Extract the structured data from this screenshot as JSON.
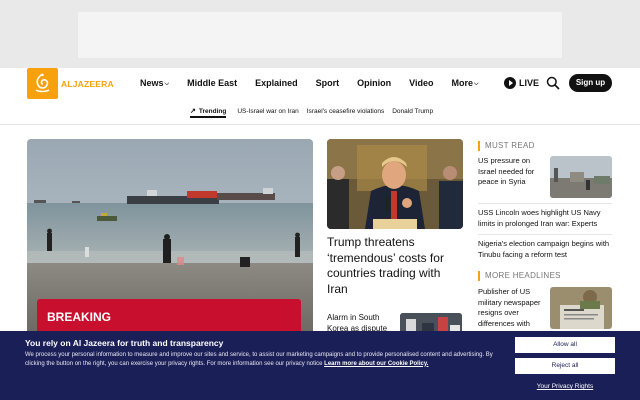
{
  "brand": {
    "name": "ALJAZEERA",
    "color": "#f7a10e"
  },
  "nav": {
    "items": [
      {
        "label": "News",
        "dropdown": true
      },
      {
        "label": "Middle East",
        "dropdown": false
      },
      {
        "label": "Explained",
        "dropdown": false
      },
      {
        "label": "Sport",
        "dropdown": false
      },
      {
        "label": "Opinion",
        "dropdown": false
      },
      {
        "label": "Video",
        "dropdown": false
      },
      {
        "label": "More",
        "dropdown": true
      }
    ],
    "live_label": "LIVE",
    "signup_label": "Sign up",
    "search_icon": "search-icon"
  },
  "trending": {
    "label": "Trending",
    "links": [
      "US-Israel war on Iran",
      "Israel's ceasefire violations",
      "Donald Trump"
    ]
  },
  "hero": {
    "badge": "BREAKING",
    "badge_color": "#c8102e"
  },
  "middle": {
    "main_title": "Trump threatens ‘tremendous’ costs for countries trading with Iran",
    "small_title": "Alarm in South Korea as dispute"
  },
  "must_read": {
    "heading": "MUST READ",
    "items": [
      "US pressure on Israel needed for peace in Syria",
      "USS Lincoln woes highlight US Navy limits in prolonged Iran war: Experts",
      "Nigeria's election campaign begins with Tinubu facing a reform test"
    ]
  },
  "more_headlines": {
    "heading": "MORE HEADLINES",
    "items": [
      "Publisher of US military newspaper resigns over differences with"
    ]
  },
  "cookie": {
    "title": "You rely on Al Jazeera for truth and transparency",
    "text": "We process your personal information to measure and improve our sites and service, to assist our marketing campaigns and to provide personalised content and advertising. By clicking the button on the right, you can exercise your privacy rights. For more information see our privacy notice",
    "link": "Learn more about our Cookie Policy.",
    "allow_label": "Allow all",
    "reject_label": "Reject all",
    "privacy_label": "Your Privacy Rights",
    "background": "#1b1f57"
  }
}
